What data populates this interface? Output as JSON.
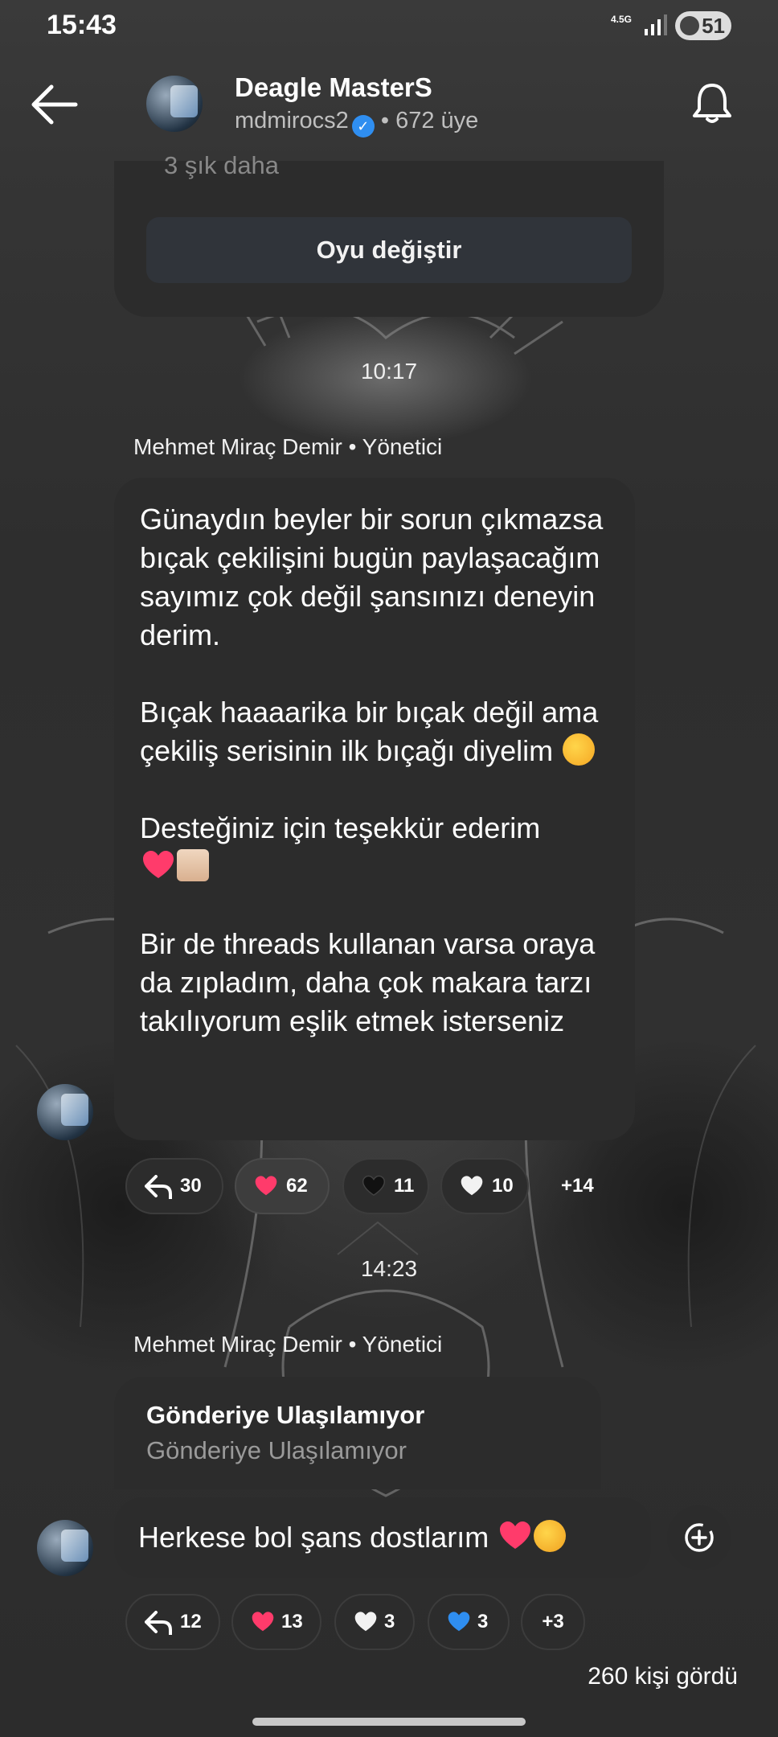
{
  "status_bar": {
    "time": "15:43",
    "network": "4.5G",
    "battery": "51"
  },
  "header": {
    "title": "Deagle MasterS",
    "handle": "mdmirocs2",
    "members": "• 672 üye"
  },
  "poll": {
    "more_options": "3 şık daha",
    "vote_button": "Oyu değiştir"
  },
  "messages": [
    {
      "time": "10:17",
      "sender": "Mehmet Miraç Demir • Yönetici",
      "paragraphs": [
        "Günaydın beyler bir sorun çıkmazsa bıçak çekilişini bugün paylaşacağım sayımız çok değil şansınızı deneyin derim.",
        "Bıçak haaaarika bir bıçak değil ama çekiliş serisinin ilk bıçağı diyelim",
        "Desteğiniz için teşekkür ederim",
        "Bir de threads kullanan varsa oraya da zıpladım, daha çok makara tarzı takılıyorum eşlik etmek isterseniz"
      ],
      "reactions": [
        {
          "icon": "reply-icon",
          "count": "30"
        },
        {
          "icon": "red-heart-icon",
          "count": "62"
        },
        {
          "icon": "black-heart-icon",
          "count": "11"
        },
        {
          "icon": "white-heart-icon",
          "count": "10"
        }
      ],
      "more_reactions": "+14"
    },
    {
      "time": "14:23",
      "sender": "Mehmet Miraç Demir • Yönetici",
      "unavailable_title": "Gönderiye Ulaşılamıyor",
      "unavailable_sub": "Gönderiye Ulaşılamıyor",
      "text": "Herkese bol şans dostlarım",
      "reactions": [
        {
          "icon": "reply-icon",
          "count": "12"
        },
        {
          "icon": "red-heart-icon",
          "count": "13"
        },
        {
          "icon": "white-heart-icon",
          "count": "3"
        },
        {
          "icon": "blue-heart-icon",
          "count": "3"
        }
      ],
      "more_reactions": "+3"
    }
  ],
  "seen_count": "260 kişi gördü",
  "colors": {
    "bubble": "#2c2c2c",
    "verified": "#2f8ef0",
    "red_heart": "#ff3b6b",
    "blue_heart": "#2f8ef0"
  }
}
